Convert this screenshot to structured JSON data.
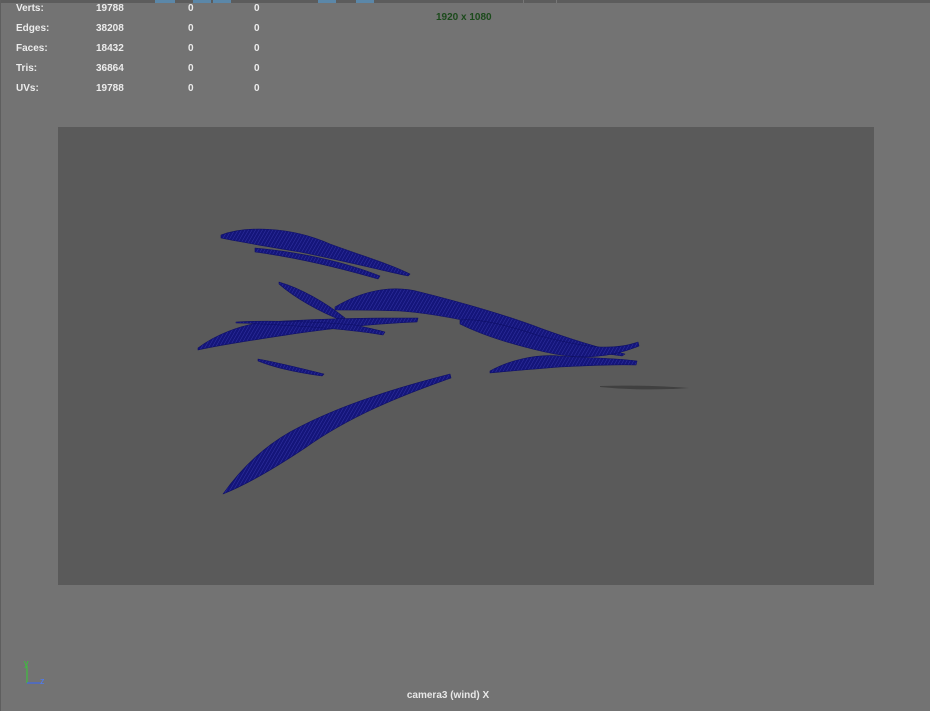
{
  "heads_up_display": {
    "rows": [
      {
        "label": "Verts:",
        "total": "19788",
        "selected": "0",
        "component": "0"
      },
      {
        "label": "Edges:",
        "total": "38208",
        "selected": "0",
        "component": "0"
      },
      {
        "label": "Faces:",
        "total": "18432",
        "selected": "0",
        "component": "0"
      },
      {
        "label": "Tris:",
        "total": "36864",
        "selected": "0",
        "component": "0"
      },
      {
        "label": "UVs:",
        "total": "19788",
        "selected": "0",
        "component": "0"
      }
    ]
  },
  "resolution": "1920 x 1080",
  "camera_label": "camera3 (wind) X",
  "axis_gizmo": {
    "y_label": "y",
    "z_label": "z"
  },
  "colors": {
    "viewport_bg": "#737373",
    "resolution_gate": "#5a5a5a",
    "mesh": "#14157a",
    "shadow": "#404040",
    "hud_text": "#ececec",
    "resolution_text": "#1b4a1b",
    "axis_y": "#33cc33",
    "axis_z": "#3366ff"
  },
  "icons": {
    "mesh": "blue-leaf-mesh-icon",
    "axis": "axis-gizmo-icon"
  }
}
